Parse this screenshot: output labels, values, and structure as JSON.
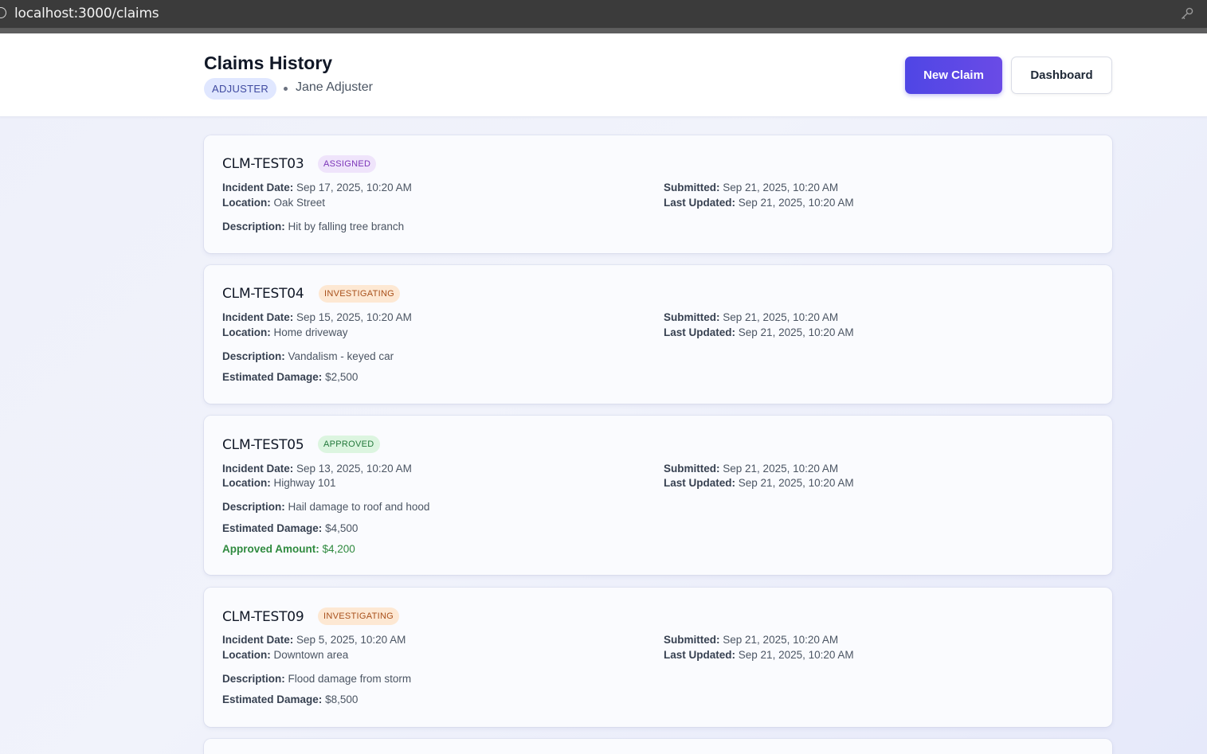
{
  "browser": {
    "url": "localhost:3000/claims"
  },
  "header": {
    "title": "Claims History",
    "role": "ADJUSTER",
    "user_name": "Jane Adjuster",
    "new_claim_label": "New Claim",
    "dashboard_label": "Dashboard"
  },
  "labels": {
    "incident_date": "Incident Date:",
    "location": "Location:",
    "submitted": "Submitted:",
    "last_updated": "Last Updated:",
    "description": "Description:",
    "estimated_damage": "Estimated Damage:",
    "approved_amount": "Approved Amount:"
  },
  "claims": [
    {
      "id": "CLM-TEST03",
      "status": "ASSIGNED",
      "incident_date": "Sep 17, 2025, 10:20 AM",
      "location": "Oak Street",
      "submitted": "Sep 21, 2025, 10:20 AM",
      "last_updated": "Sep 21, 2025, 10:20 AM",
      "description": "Hit by falling tree branch"
    },
    {
      "id": "CLM-TEST04",
      "status": "INVESTIGATING",
      "incident_date": "Sep 15, 2025, 10:20 AM",
      "location": "Home driveway",
      "submitted": "Sep 21, 2025, 10:20 AM",
      "last_updated": "Sep 21, 2025, 10:20 AM",
      "description": "Vandalism - keyed car",
      "estimated_damage": "$2,500"
    },
    {
      "id": "CLM-TEST05",
      "status": "APPROVED",
      "incident_date": "Sep 13, 2025, 10:20 AM",
      "location": "Highway 101",
      "submitted": "Sep 21, 2025, 10:20 AM",
      "last_updated": "Sep 21, 2025, 10:20 AM",
      "description": "Hail damage to roof and hood",
      "estimated_damage": "$4,500",
      "approved_amount": "$4,200"
    },
    {
      "id": "CLM-TEST09",
      "status": "INVESTIGATING",
      "incident_date": "Sep 5, 2025, 10:20 AM",
      "location": "Downtown area",
      "submitted": "Sep 21, 2025, 10:20 AM",
      "last_updated": "Sep 21, 2025, 10:20 AM",
      "description": "Flood damage from storm",
      "estimated_damage": "$8,500"
    }
  ],
  "colors": {
    "primary": "#4f46e5",
    "status_assigned": "#7b34b8",
    "status_investigating": "#a8501b",
    "status_approved": "#22783a",
    "approved_amount": "#2f8a3f"
  },
  "icons": [
    "reload-icon",
    "key-icon"
  ]
}
